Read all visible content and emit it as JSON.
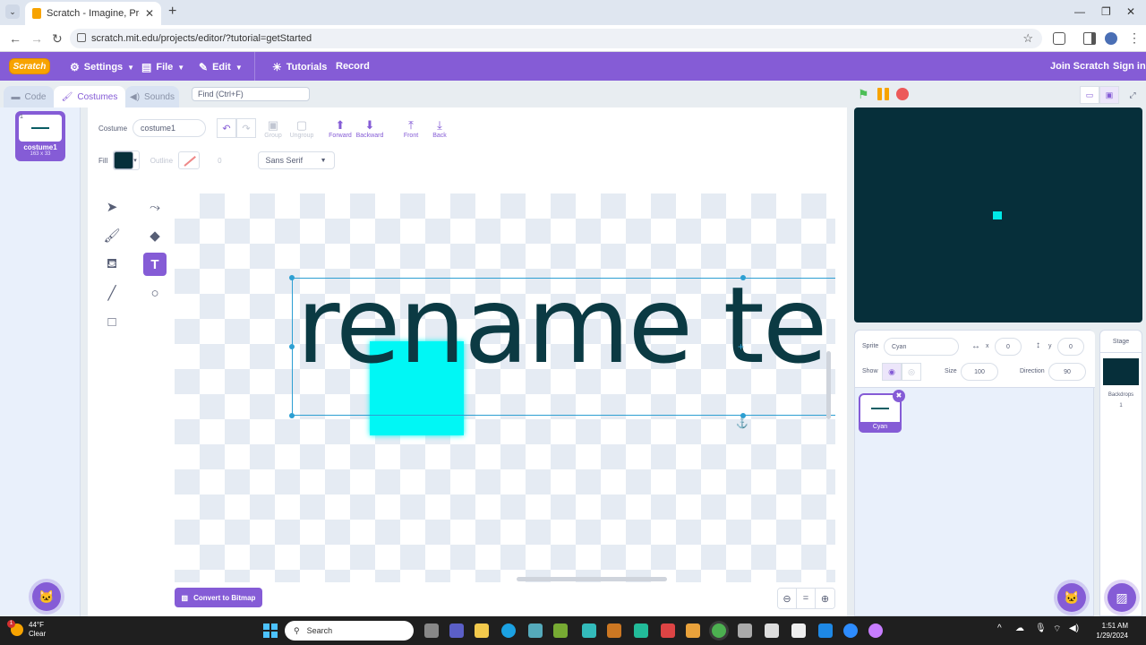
{
  "browser": {
    "tab_title": "Scratch - Imagine, Program, Sh",
    "url": "scratch.mit.edu/projects/editor/?tutorial=getStarted"
  },
  "menubar": {
    "logo": "Scratch",
    "settings": "Settings",
    "file": "File",
    "edit": "Edit",
    "tutorials": "Tutorials",
    "record": "Record",
    "join": "Join Scratch",
    "signin": "Sign in"
  },
  "editor_tabs": {
    "code": "Code",
    "costumes": "Costumes",
    "sounds": "Sounds"
  },
  "find_placeholder": "Find (Ctrl+F)",
  "costume_list": [
    {
      "index": "1",
      "name": "costume1",
      "size": "163 x 33"
    }
  ],
  "paint": {
    "costume_label": "Costume",
    "costume_name": "costume1",
    "group": "Group",
    "ungroup": "Ungroup",
    "forward": "Forward",
    "backward": "Backward",
    "front": "Front",
    "back": "Back",
    "fill_label": "Fill",
    "fill_color": "#062f3a",
    "outline_label": "Outline",
    "outline_width": "0",
    "font": "Sans Serif",
    "canvas_text": "rename te",
    "convert_button": "Convert to Bitmap",
    "zoom_reset": "="
  },
  "sprite_info": {
    "sprite_label": "Sprite",
    "sprite_name": "Cyan",
    "x_label": "x",
    "x_value": "0",
    "y_label": "y",
    "y_value": "0",
    "show_label": "Show",
    "size_label": "Size",
    "size_value": "100",
    "direction_label": "Direction",
    "direction_value": "90"
  },
  "sprites": [
    {
      "name": "Cyan"
    }
  ],
  "stage_pane": {
    "title": "Stage",
    "backdrops_label": "Backdrops",
    "backdrops_count": "1"
  },
  "colors": {
    "accent": "#855cd6",
    "stage_bg": "#062f3a",
    "sprite_cyan": "#00f7f5"
  },
  "taskbar": {
    "temp": "44°F",
    "weather": "Clear",
    "search": "Search",
    "time": "1:51 AM",
    "date": "1/29/2024",
    "notification_count": "1"
  }
}
